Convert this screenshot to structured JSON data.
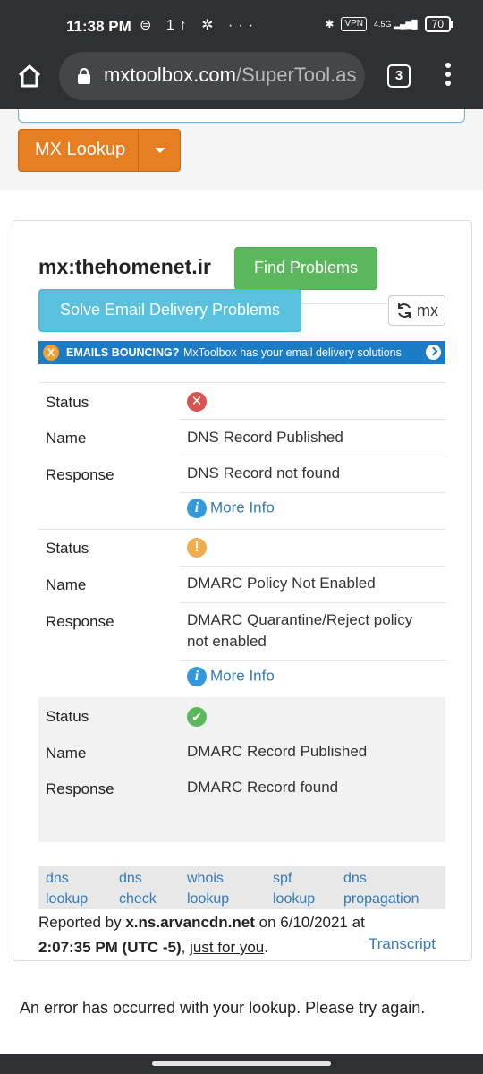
{
  "status_bar": {
    "time": "11:38 PM",
    "left_icons": "⊜ 1↑ ✲ ···",
    "vpn": "VPN",
    "network": "4.5G",
    "battery": "70"
  },
  "browser": {
    "url_main": "mxtoolbox.com",
    "url_path": "/SuperTool.as",
    "tab_count": "3"
  },
  "lookup_button": {
    "label": "MX Lookup"
  },
  "panel": {
    "domain_title": "mx:thehomenet.ir",
    "find_problems": "Find Problems",
    "solve_delivery": "Solve Email Delivery Problems",
    "refresh_label": "mx",
    "banner": {
      "badge": "X",
      "headline": "EMAILS BOUNCING?",
      "text": "MxToolbox has your email delivery solutions"
    }
  },
  "results": [
    {
      "status_label": "Status",
      "status": "error",
      "name_label": "Name",
      "name": "DNS Record Published",
      "response_label": "Response",
      "response": "DNS Record not found",
      "more_info": "More Info"
    },
    {
      "status_label": "Status",
      "status": "warning",
      "name_label": "Name",
      "name": "DMARC Policy Not Enabled",
      "response_label": "Response",
      "response": "DMARC Quarantine/Reject policy not enabled",
      "more_info": "More Info"
    },
    {
      "status_label": "Status",
      "status": "ok",
      "name_label": "Name",
      "name": "DMARC Record Published",
      "response_label": "Response",
      "response": "DMARC Record found"
    }
  ],
  "status_colors": {
    "error": "#d9534f",
    "warning": "#f0ad4e",
    "ok": "#5cb85c"
  },
  "tools": [
    {
      "line1": "dns",
      "line2": "lookup"
    },
    {
      "line1": "dns",
      "line2": "check"
    },
    {
      "line1": "whois",
      "line2": "lookup"
    },
    {
      "line1": "spf",
      "line2": "lookup"
    },
    {
      "line1": "dns",
      "line2": "propagation"
    }
  ],
  "report": {
    "prefix": "Reported by ",
    "server": "x.ns.arvancdn.net",
    "on": " on 6/10/2021 at",
    "time": "2:07:35 PM (UTC -5)",
    "comma": ", ",
    "just_for_you": "just for you",
    "period": ".",
    "transcript": "Transcript"
  },
  "error_message": "An error has occurred with your lookup. Please try again."
}
